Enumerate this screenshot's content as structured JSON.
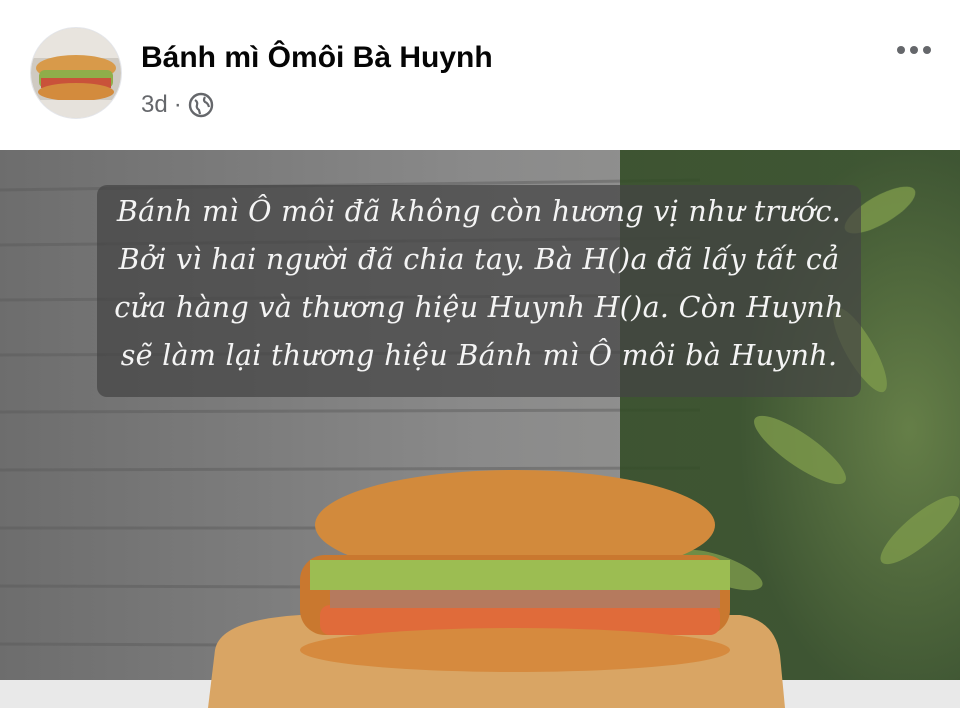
{
  "post": {
    "page_name": "Bánh mì Ômôi Bà Huynh",
    "time": "3d",
    "separator": "·",
    "privacy_icon": "globe-icon",
    "more_icon": "more-options-icon"
  },
  "image": {
    "caption_lines": [
      "Bánh mì Ô môi đã không còn hương vị như trước.",
      "Bởi vì hai người đã chia tay. Bà H()a đã lấy tất cả",
      "cửa hàng và thương hiệu Huynh H()a. Còn Huynh",
      "sẽ làm lại thương hiệu Bánh mì Ô môi bà Huynh."
    ]
  },
  "colors": {
    "name_text": "#050505",
    "meta_text": "#65676b",
    "caption_box": "#444444",
    "caption_text": "#f4f4f4"
  }
}
